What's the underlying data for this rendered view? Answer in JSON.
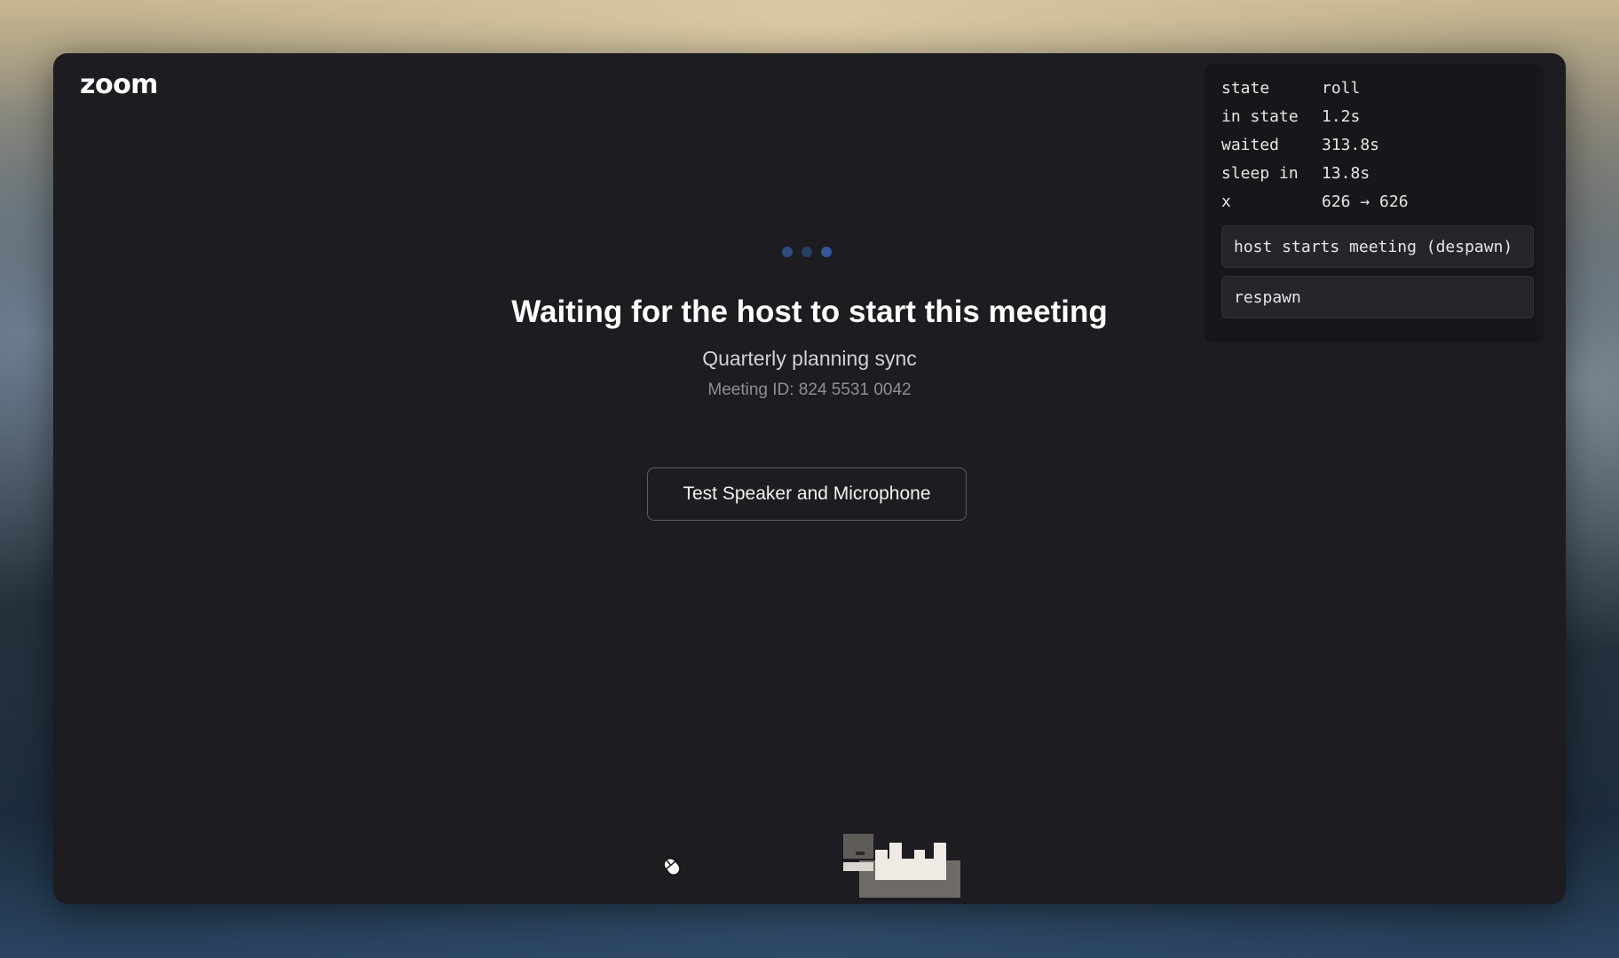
{
  "app": {
    "logo_text": "zoom"
  },
  "debug": {
    "rows": [
      {
        "key": "state",
        "value": "roll"
      },
      {
        "key": "in state",
        "value": "1.2s"
      },
      {
        "key": "waited",
        "value": "313.8s"
      },
      {
        "key": "sleep in",
        "value": "13.8s"
      },
      {
        "key": "x",
        "value": "626 → 626"
      }
    ],
    "buttons": {
      "host_starts": "host starts meeting (despawn)",
      "respawn": "respawn"
    }
  },
  "main": {
    "title": "Waiting for the host to start this meeting",
    "meeting_name": "Quarterly planning sync",
    "meeting_id": "Meeting ID: 824 5531 0042",
    "test_button_label": "Test Speaker and Microphone"
  },
  "colors": {
    "window_bg": "#1c1c21",
    "panel_bg": "#17171b",
    "loading_dot": "#34589a",
    "text_primary": "#ffffff"
  },
  "icons": {
    "loading": "loading-dots-icon",
    "pet": "pixel-cat-icon",
    "cursor": "mouse-cursor-icon"
  }
}
